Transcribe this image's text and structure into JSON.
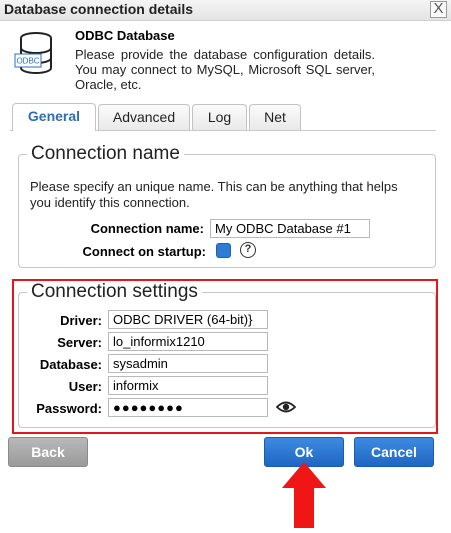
{
  "window": {
    "title": "Database connection details",
    "close_label": "X"
  },
  "header": {
    "icon_label": "ODBC",
    "title": "ODBC Database",
    "description": "Please provide the database configuration details. You may connect to MySQL, Microsoft SQL server, Oracle, etc."
  },
  "tabs": [
    {
      "label": "General",
      "active": true
    },
    {
      "label": "Advanced",
      "active": false
    },
    {
      "label": "Log",
      "active": false
    },
    {
      "label": "Net",
      "active": false
    }
  ],
  "connection_name": {
    "legend": "Connection name",
    "info": "Please specify an unique name. This can be anything that helps you identify this connection.",
    "name_label": "Connection name:",
    "name_value": "My ODBC Database #1",
    "startup_label": "Connect on startup:",
    "startup_checked": true,
    "help_label": "?"
  },
  "connection_settings": {
    "legend": "Connection settings",
    "driver_label": "Driver:",
    "driver_value": "ODBC DRIVER (64-bit)}",
    "server_label": "Server:",
    "server_value": "lo_informix1210",
    "database_label": "Database:",
    "database_value": "sysadmin",
    "user_label": "User:",
    "user_value": "informix",
    "password_label": "Password:",
    "password_value": "●●●●●●●●"
  },
  "buttons": {
    "back": "Back",
    "ok": "Ok",
    "cancel": "Cancel"
  },
  "colors": {
    "accent": "#2a6fb8",
    "button_blue": "#1f66c4",
    "highlight_red": "#e0181e",
    "back_gray": "#9a9a9a"
  },
  "icons": [
    "database-icon",
    "close-icon",
    "help-icon",
    "eye-icon",
    "arrow-up-icon"
  ]
}
